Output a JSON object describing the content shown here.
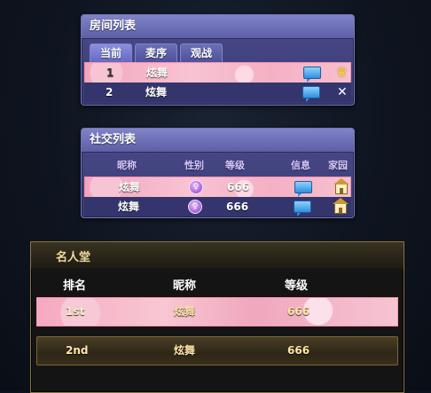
{
  "room_list": {
    "title": "房间列表",
    "tabs": [
      {
        "label": "当前"
      },
      {
        "label": "麦序"
      },
      {
        "label": "观战"
      }
    ],
    "rows": [
      {
        "index": "1",
        "name": "炫舞",
        "selected": true,
        "action_icon": "crown-icon"
      },
      {
        "index": "2",
        "name": "炫舞",
        "selected": false,
        "action_icon": "close-icon"
      }
    ]
  },
  "social_list": {
    "title": "社交列表",
    "headers": {
      "nickname": "昵称",
      "gender": "性别",
      "level": "等级",
      "info": "信息",
      "home": "家园"
    },
    "rows": [
      {
        "name": "炫舞",
        "gender_icon": "female-icon",
        "level": "666",
        "selected": true
      },
      {
        "name": "炫舞",
        "gender_icon": "female-icon",
        "level": "666",
        "selected": false
      }
    ]
  },
  "hall_of_fame": {
    "title": "名人堂",
    "headers": {
      "rank": "排名",
      "nickname": "昵称",
      "level": "等级"
    },
    "rows": [
      {
        "rank": "1st",
        "name": "炫舞",
        "level": "666"
      },
      {
        "rank": "2nd",
        "name": "炫舞",
        "level": "666"
      }
    ]
  },
  "colors": {
    "panel": "#4a4a8a",
    "selected_row": "#f5a9c0",
    "fame_border": "#8a7440",
    "gold_text": "#ffe6a6"
  }
}
